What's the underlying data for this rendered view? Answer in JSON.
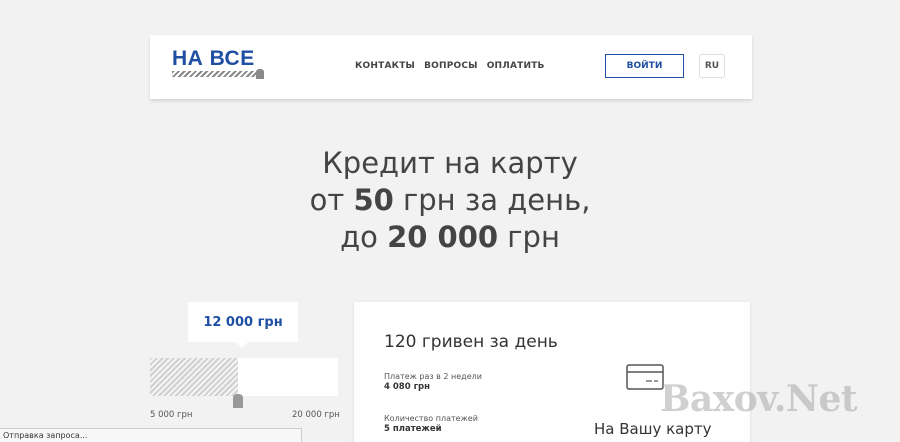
{
  "header": {
    "logo_text": "НА ВСЕ",
    "nav": [
      "КОНТАКТЫ",
      "ВОПРОСЫ",
      "ОПЛАТИТЬ"
    ],
    "login_label": "ВОЙТИ",
    "lang_label": "RU"
  },
  "headline": {
    "line1": "Кредит на карту",
    "line2_pre": "от ",
    "line2_bold": "50",
    "line2_post": " грн за день,",
    "line3_pre": "до ",
    "line3_bold": "20 000",
    "line3_post": " грн"
  },
  "slider": {
    "amount": "12 000 грн",
    "min_label": "5 000 грн",
    "max_label": "20 000 грн",
    "fraction": 0.466
  },
  "card": {
    "title": "120 гривен за день",
    "payment_label": "Платеж раз в 2 недели",
    "payment_value": "4 080 грн",
    "count_label": "Количество платежей",
    "count_value": "5 платежей",
    "to_card": "На Вашу карту"
  },
  "watermark": "Baxov.Net",
  "status_text": "Отправка запроса...",
  "colors": {
    "brand": "#1f4fa3",
    "background": "#f2f2f2"
  },
  "icons": [
    "credit-card-icon"
  ]
}
